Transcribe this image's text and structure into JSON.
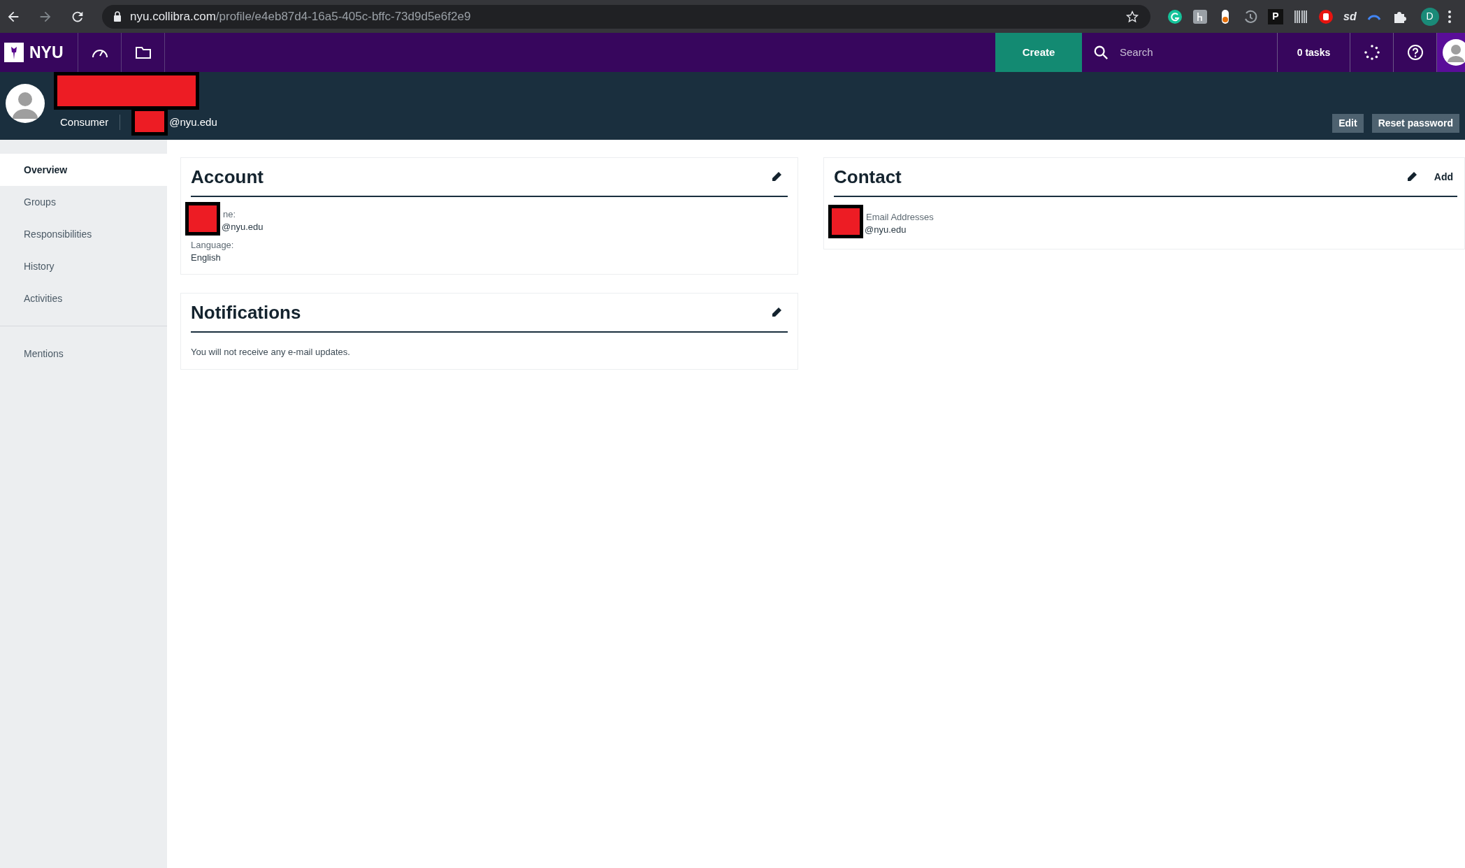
{
  "browser": {
    "url_host": "nyu.collibra.com",
    "url_path": "/profile/e4eb87d4-16a5-405c-bffc-73d9d5e6f2e9",
    "extensions": [
      {
        "kind": "round",
        "color": "#15c39a"
      },
      {
        "kind": "square",
        "color": "#9aa0a6"
      },
      {
        "kind": "pill",
        "color": "#e8710a"
      },
      {
        "kind": "history",
        "color": "#9aa0a6"
      },
      {
        "kind": "letter",
        "color": "#111111",
        "label": "P"
      },
      {
        "kind": "barcode",
        "color": "#bdc1c6"
      },
      {
        "kind": "stop",
        "color": "#e8130f"
      },
      {
        "kind": "text",
        "color": "#e8eaed",
        "label": "sd"
      },
      {
        "kind": "arc",
        "color": "#4285f4"
      },
      {
        "kind": "puzzle",
        "color": "#e8eaed"
      }
    ],
    "profile_initial": "D"
  },
  "nav": {
    "logo": "NYU",
    "create": "Create",
    "search_placeholder": "Search",
    "tasks": "0 tasks"
  },
  "header": {
    "role": "Consumer",
    "email_suffix": "@nyu.edu",
    "buttons": [
      "Edit",
      "Reset password"
    ]
  },
  "sidebar": {
    "groups": [
      {
        "items": [
          {
            "label": "Overview",
            "selected": true
          },
          {
            "label": "Groups",
            "selected": false
          },
          {
            "label": "Responsibilities",
            "selected": false
          },
          {
            "label": "History",
            "selected": false
          },
          {
            "label": "Activities",
            "selected": false
          }
        ]
      },
      {
        "items": [
          {
            "label": "Mentions",
            "selected": false
          }
        ]
      }
    ]
  },
  "account": {
    "title": "Account",
    "fields": [
      {
        "label": "ne:",
        "value": "@nyu.edu",
        "redacted": true
      },
      {
        "label": "Language:",
        "value": "English",
        "redacted": false
      }
    ]
  },
  "notifications": {
    "title": "Notifications",
    "text": "You will not receive any e-mail updates."
  },
  "contact": {
    "title": "Contact",
    "action": "Add",
    "fields": [
      {
        "label": "Email Addresses",
        "value": "@nyu.edu",
        "redacted": true
      }
    ]
  }
}
